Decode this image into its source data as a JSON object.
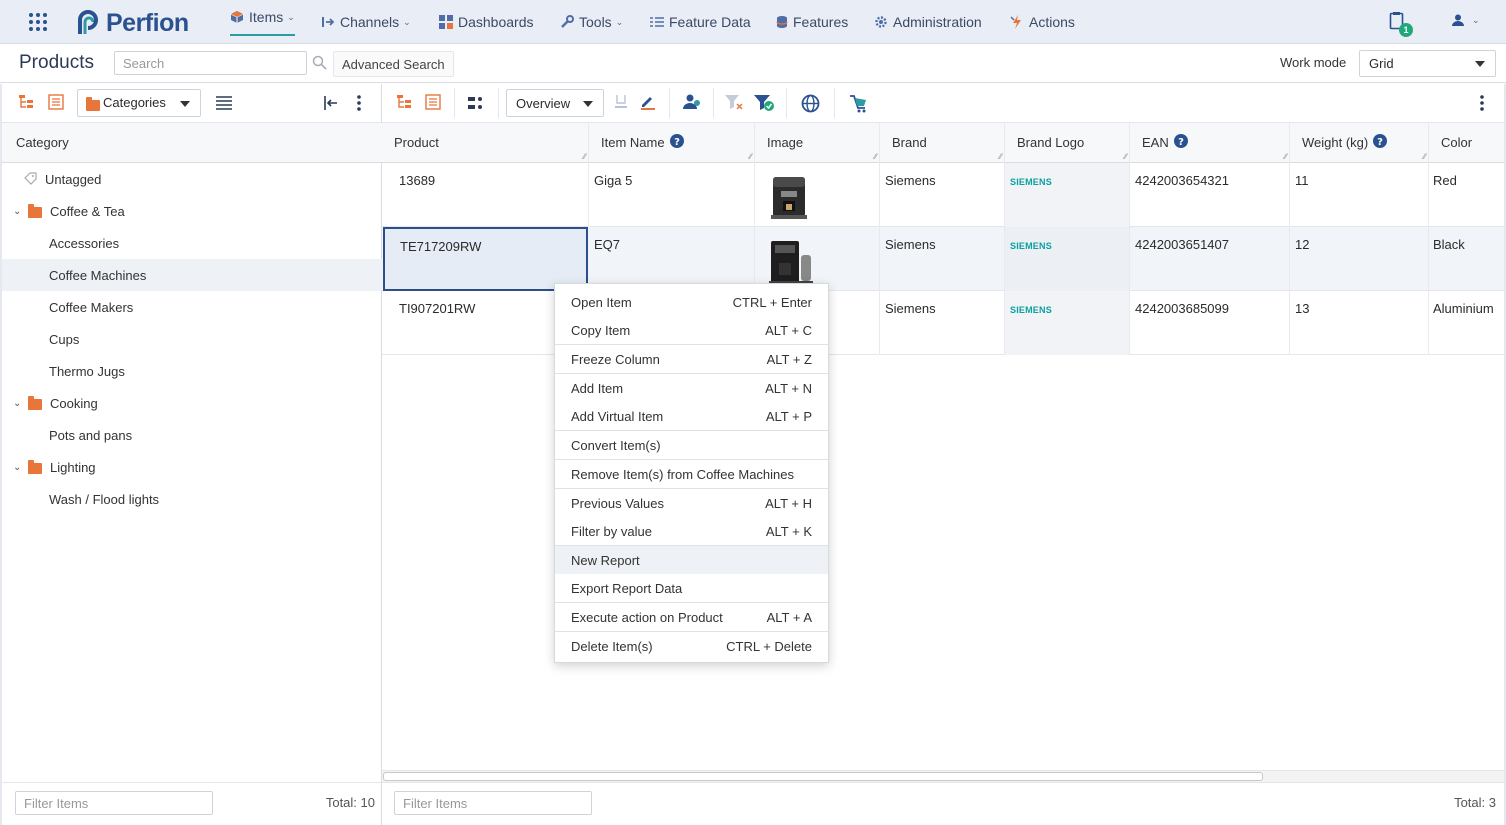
{
  "nav": {
    "brand": "Perfion",
    "items": [
      {
        "label": "Items",
        "icon": "cube-icon",
        "chevron": true
      },
      {
        "label": "Channels",
        "icon": "channel-icon",
        "chevron": true
      },
      {
        "label": "Dashboards",
        "icon": "dashboard-icon",
        "chevron": false
      },
      {
        "label": "Tools",
        "icon": "wrench-icon",
        "chevron": true
      },
      {
        "label": "Feature Data",
        "icon": "list-icon",
        "chevron": false
      },
      {
        "label": "Features",
        "icon": "database-icon",
        "chevron": false
      },
      {
        "label": "Administration",
        "icon": "gear-icon",
        "chevron": false
      },
      {
        "label": "Actions",
        "icon": "lightning-icon",
        "chevron": false
      }
    ],
    "notification_count": "1"
  },
  "titlebar": {
    "title": "Products",
    "search_placeholder": "Search",
    "advanced_search": "Advanced Search",
    "work_mode_label": "Work mode",
    "work_mode_value": "Grid"
  },
  "left": {
    "category_select": "Categories",
    "header": "Category",
    "tree": [
      {
        "label": "Untagged",
        "type": "tag"
      },
      {
        "label": "Coffee & Tea",
        "type": "folder"
      },
      {
        "label": "Accessories",
        "type": "leaf"
      },
      {
        "label": "Coffee Machines",
        "type": "leaf",
        "selected": true
      },
      {
        "label": "Coffee Makers",
        "type": "leaf"
      },
      {
        "label": "Cups",
        "type": "leaf"
      },
      {
        "label": "Thermo Jugs",
        "type": "leaf"
      },
      {
        "label": "Cooking",
        "type": "folder"
      },
      {
        "label": "Pots and pans",
        "type": "leaf"
      },
      {
        "label": "Lighting",
        "type": "folder"
      },
      {
        "label": "Wash / Flood lights",
        "type": "leaf"
      }
    ],
    "filter_placeholder": "Filter Items",
    "total": "Total: 10"
  },
  "right": {
    "view_select": "Overview",
    "columns": [
      "Product",
      "Item Name",
      "Image",
      "Brand",
      "Brand Logo",
      "EAN",
      "Weight (kg)",
      "Color"
    ],
    "rows": [
      {
        "product": "13689",
        "item_name": "Giga 5",
        "brand": "Siemens",
        "logo": "SIEMENS",
        "ean": "4242003654321",
        "weight": "11",
        "color": "Red"
      },
      {
        "product": "TE717209RW",
        "item_name": "EQ7",
        "brand": "Siemens",
        "logo": "SIEMENS",
        "ean": "4242003651407",
        "weight": "12",
        "color": "Black"
      },
      {
        "product": "TI907201RW",
        "item_name": "",
        "brand": "Siemens",
        "logo": "SIEMENS",
        "ean": "4242003685099",
        "weight": "13",
        "color": "Aluminium"
      }
    ],
    "filter_placeholder": "Filter Items",
    "total": "Total: 3"
  },
  "context_menu": {
    "items": [
      {
        "label": "Open Item",
        "shortcut": "CTRL + Enter"
      },
      {
        "label": "Copy Item",
        "shortcut": "ALT + C"
      },
      {
        "label": "Freeze Column",
        "shortcut": "ALT + Z"
      },
      {
        "label": "Add Item",
        "shortcut": "ALT + N"
      },
      {
        "label": "Add Virtual Item",
        "shortcut": "ALT + P"
      },
      {
        "label": "Convert Item(s)",
        "shortcut": ""
      },
      {
        "label": "Remove Item(s) from Coffee Machines",
        "shortcut": ""
      },
      {
        "label": "Previous Values",
        "shortcut": "ALT + H"
      },
      {
        "label": "Filter by value",
        "shortcut": "ALT + K"
      },
      {
        "label": "New Report",
        "shortcut": ""
      },
      {
        "label": "Export Report Data",
        "shortcut": ""
      },
      {
        "label": "Execute action on Product",
        "shortcut": "ALT + A"
      },
      {
        "label": "Delete Item(s)",
        "shortcut": "CTRL + Delete"
      }
    ]
  },
  "colors": {
    "brand": "#2a5190",
    "accent": "#2e9aa5",
    "folder": "#e8763a",
    "siemens": "#0aa0a0",
    "selection": "#2a4f8a"
  }
}
